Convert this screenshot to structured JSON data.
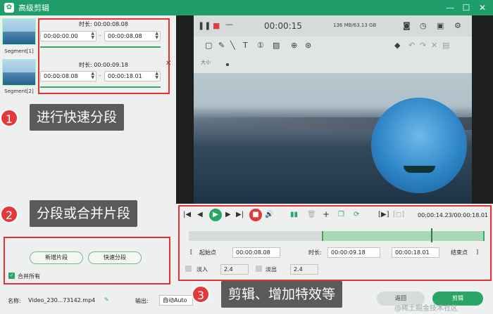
{
  "window": {
    "title": "高级剪辑",
    "minimize": "—",
    "maximize": "☐",
    "close": "✕"
  },
  "segments": [
    {
      "label": "Segment[1]",
      "duration": "时长: 00:00:08.08",
      "start": "00:00:00.00",
      "end": "00:00:08.08"
    },
    {
      "label": "Segment[2]",
      "duration": "时长: 00:00:09.18",
      "start": "00:00:08.08",
      "end": "00:00:18.01"
    }
  ],
  "callouts": [
    {
      "num": "1",
      "text": "进行快速分段"
    },
    {
      "num": "2",
      "text": "分段或合并片段"
    },
    {
      "num": "3",
      "text": "剪辑、增加特效等"
    }
  ],
  "segment_actions": {
    "new_segment": "新增片段",
    "quick_split": "快速分段",
    "merge_all": "合并所有"
  },
  "recorder": {
    "time": "00:00:15",
    "size": "136 MB/63.13 GB",
    "size_label": "大小"
  },
  "timeline": {
    "time_display": "00:00:14.23/00:00:18.01",
    "start_label": "起始点",
    "start_value": "00:00:08.08",
    "duration_label": "时长:",
    "duration_value": "00:00:09.18",
    "end_value": "00:00:18.01",
    "end_label": "结束点",
    "fade_in_label": "淡入",
    "fade_in_value": "2.4",
    "fade_out_label": "淡出",
    "fade_out_value": "2.4"
  },
  "footer": {
    "name_label": "名称:",
    "filename": "Video_230...73142.mp4",
    "output_label": "输出:",
    "output_value": "自动Auto",
    "back_button": "返回",
    "cut_button": "剪辑"
  },
  "watermark": "@稀土掘金技术社区",
  "colors": {
    "brand": "#1f9e6c",
    "highlight": "#e5312f",
    "accent": "#3ca56c"
  }
}
